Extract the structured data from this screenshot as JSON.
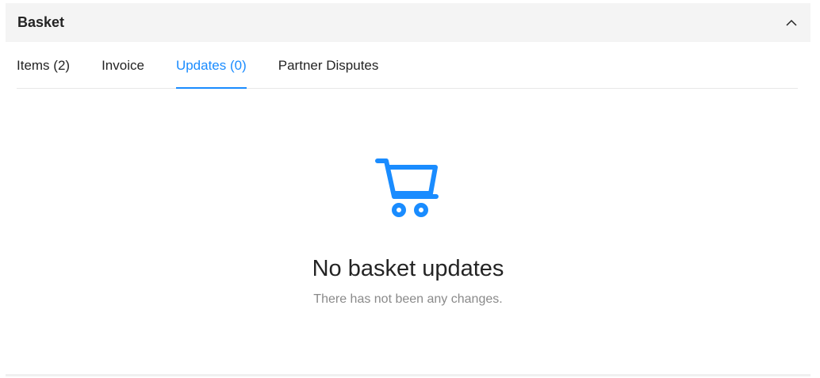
{
  "panel": {
    "title": "Basket",
    "collapse_icon": "chevron-up-icon"
  },
  "tabs": [
    {
      "label": "Items (2)",
      "active": false
    },
    {
      "label": "Invoice",
      "active": false
    },
    {
      "label": "Updates (0)",
      "active": true
    },
    {
      "label": "Partner Disputes",
      "active": false
    }
  ],
  "empty_state": {
    "icon": "shopping-cart-icon",
    "title": "No basket updates",
    "subtitle": "There has not been any changes."
  },
  "colors": {
    "accent": "#1a8cff",
    "header_bg": "#f4f4f4",
    "text": "#242424",
    "muted_text": "#8a8a8a"
  }
}
